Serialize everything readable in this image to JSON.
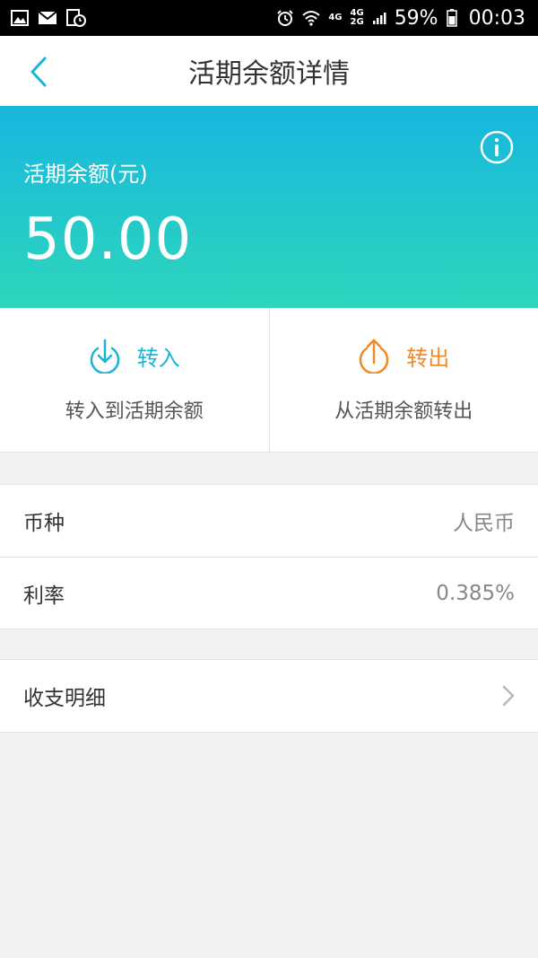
{
  "status_bar": {
    "net1": "4G",
    "net2_top": "4G",
    "net2_bottom": "2G",
    "battery": "59%",
    "time": "00:03"
  },
  "nav": {
    "title": "活期余额详情"
  },
  "balance": {
    "label": "活期余额(元)",
    "amount": "50.00"
  },
  "actions": {
    "transfer_in": {
      "label": "转入",
      "sub": "转入到活期余额",
      "color": "#1ab4d6"
    },
    "transfer_out": {
      "label": "转出",
      "sub": "从活期余额转出",
      "color": "#f08a24"
    }
  },
  "info": {
    "currency_label": "币种",
    "currency_value": "人民币",
    "rate_label": "利率",
    "rate_value": "0.385%"
  },
  "details": {
    "label": "收支明细"
  }
}
